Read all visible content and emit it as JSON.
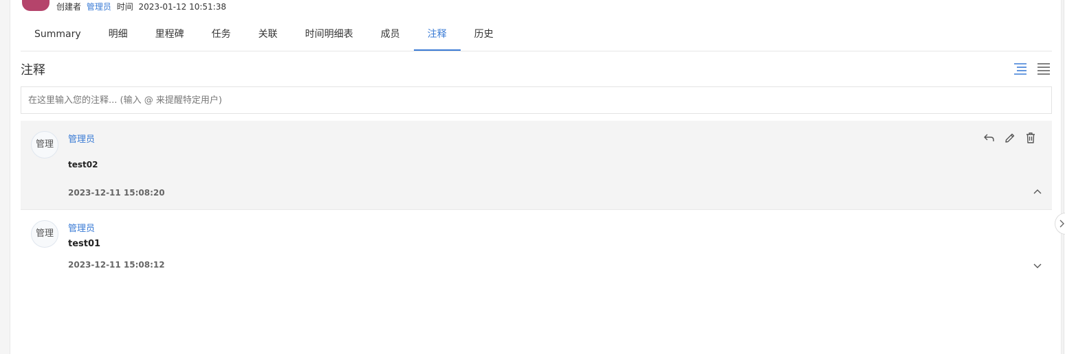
{
  "header": {
    "creator_label": "创建者",
    "creator_name": "管理员",
    "time_label": "时间",
    "time_value": "2023-01-12 10:51:38"
  },
  "tabs": [
    {
      "label": "Summary"
    },
    {
      "label": "明细"
    },
    {
      "label": "里程碑"
    },
    {
      "label": "任务"
    },
    {
      "label": "关联"
    },
    {
      "label": "时间明细表"
    },
    {
      "label": "成员"
    },
    {
      "label": "注释",
      "active": true
    },
    {
      "label": "历史"
    }
  ],
  "section": {
    "title": "注释",
    "input_placeholder": "在这里输入您的注释... (输入 @ 来提醒特定用户)"
  },
  "comments": [
    {
      "avatar_text": "管理",
      "author": "管理员",
      "body": "test02",
      "timestamp": "2023-12-11 15:08:20",
      "expanded": true
    },
    {
      "avatar_text": "管理",
      "author": "管理员",
      "body": "test01",
      "timestamp": "2023-12-11 15:08:12",
      "expanded": false
    }
  ],
  "colors": {
    "accent": "#3a7bd5",
    "logo": "#b5446b",
    "highlight_row": "#f4f4f4"
  },
  "icons": {
    "view_threaded": "threaded-view-icon",
    "view_list": "list-view-icon",
    "reply": "reply-icon",
    "edit": "pencil-icon",
    "delete": "trash-icon",
    "collapse": "chevron-up-icon",
    "expand": "chevron-down-icon",
    "side_panel": "chevron-right-icon"
  }
}
